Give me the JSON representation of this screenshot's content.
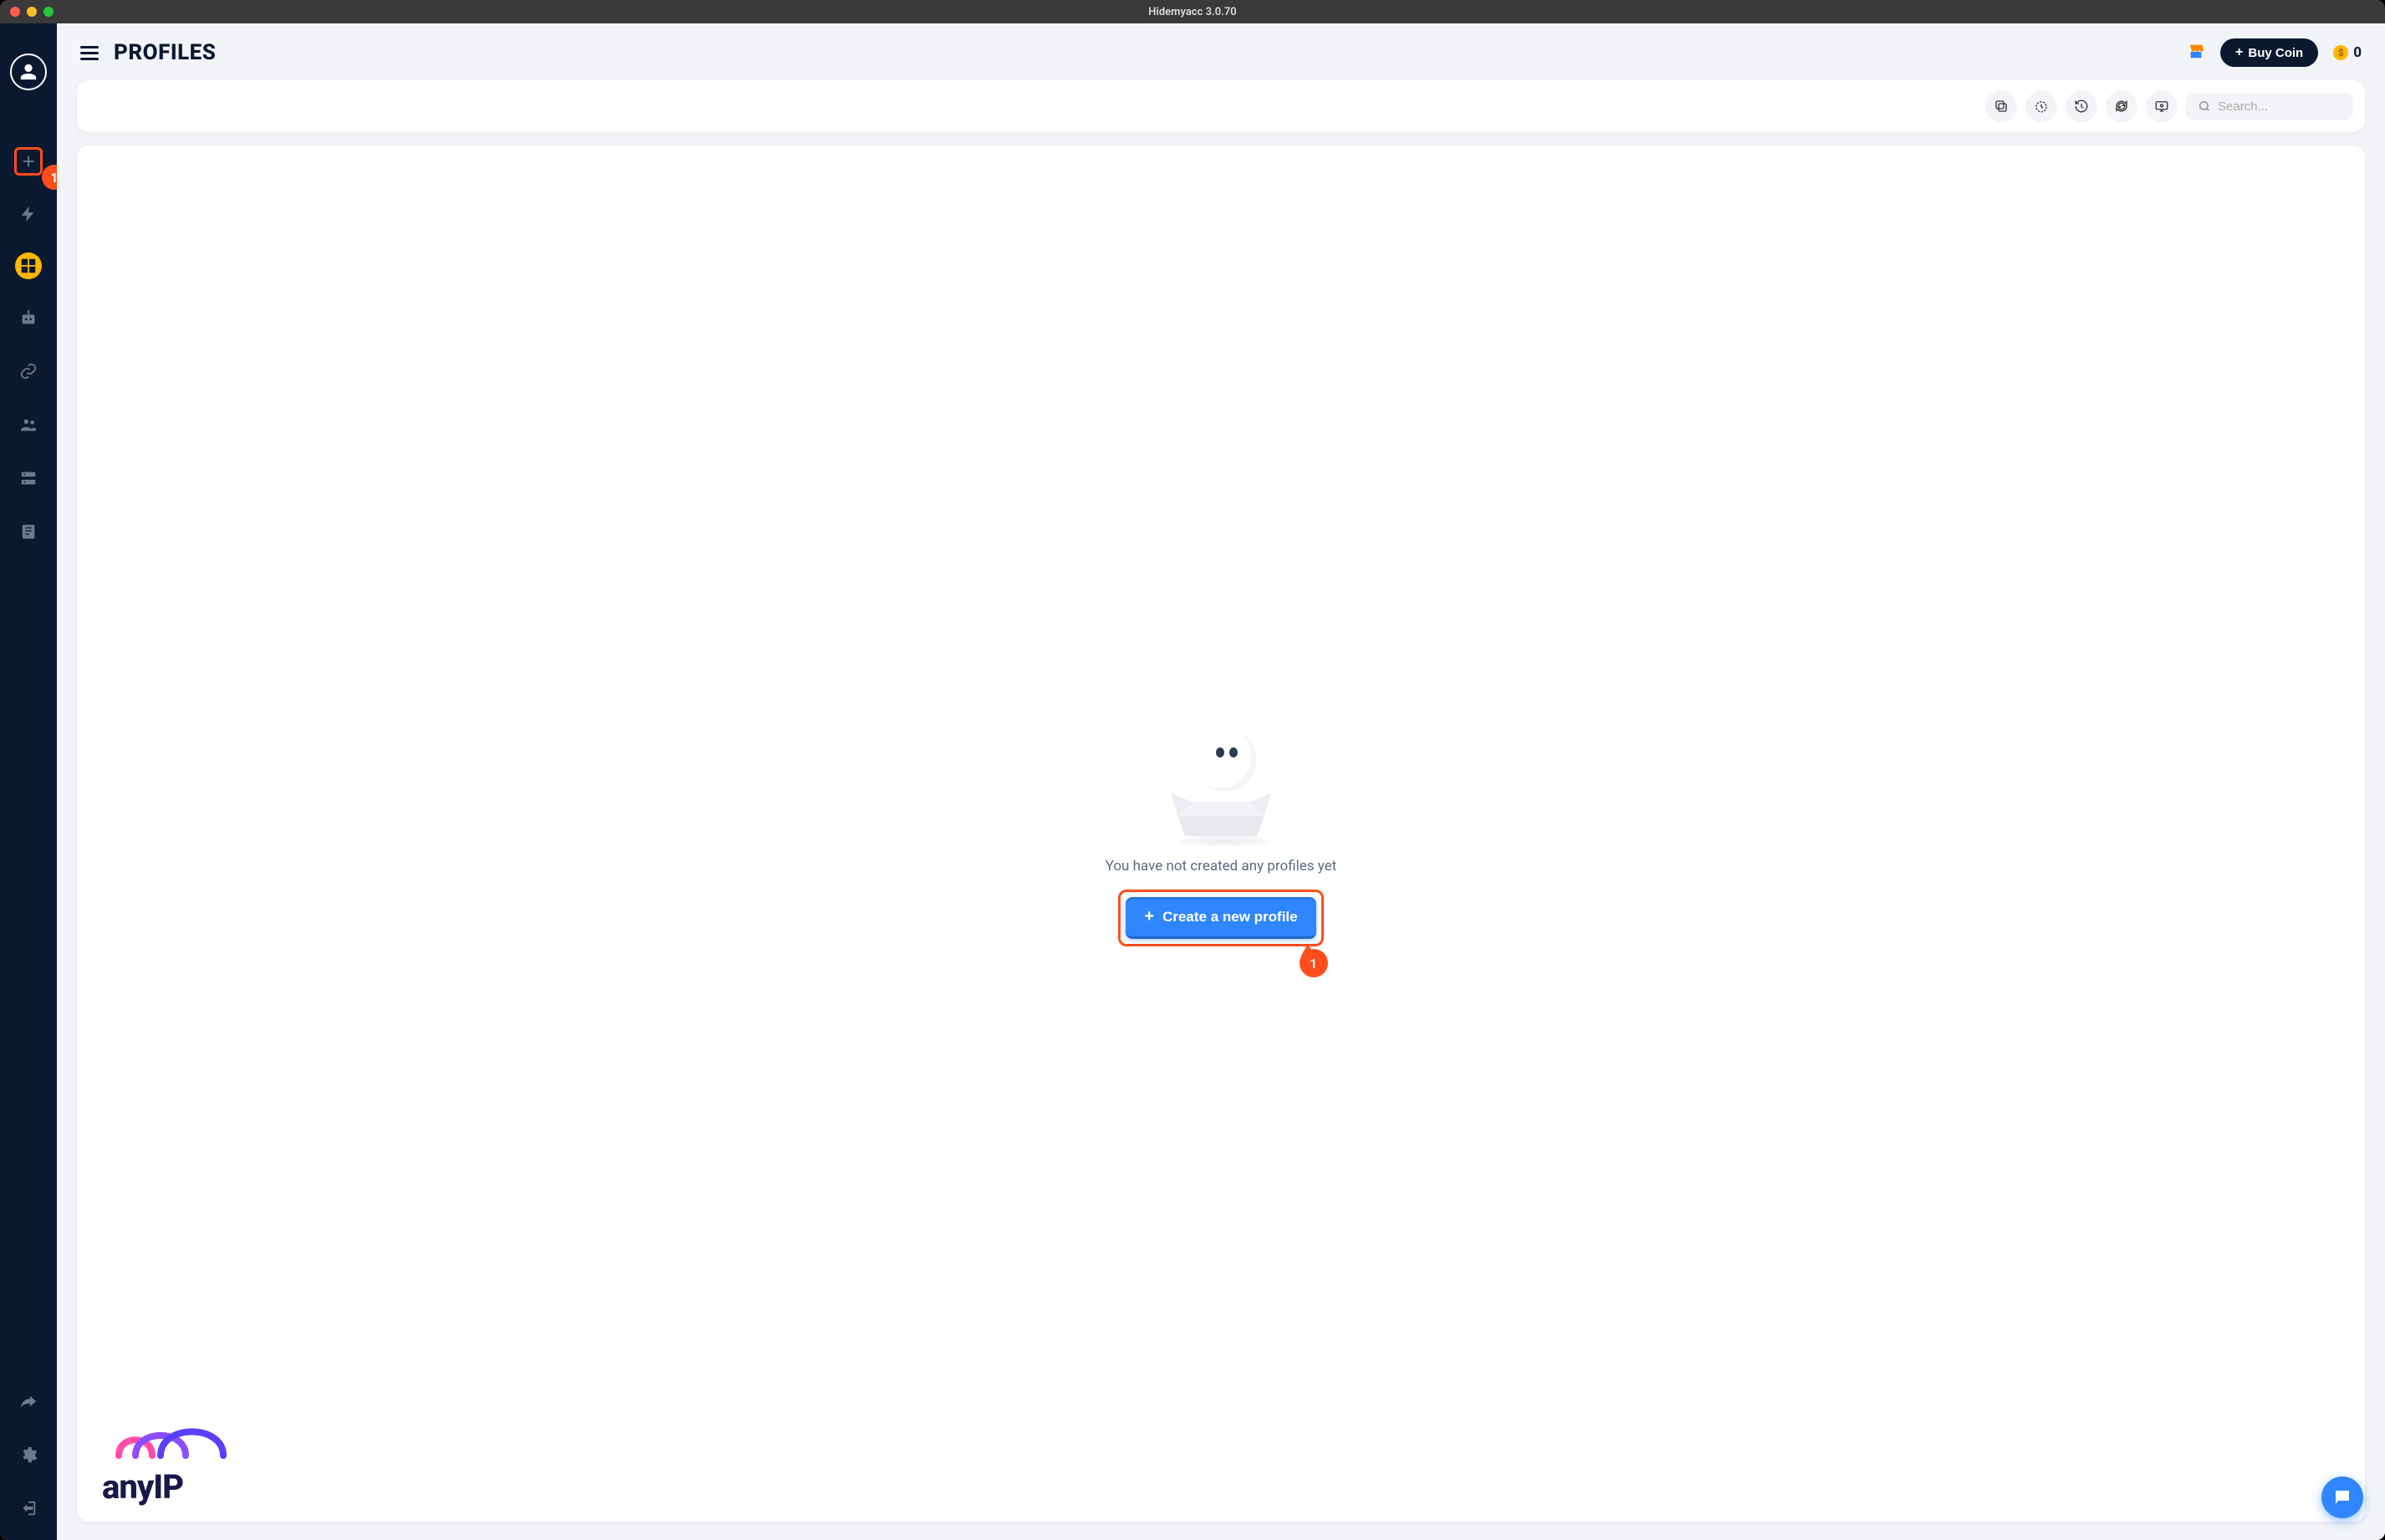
{
  "window": {
    "title": "Hidemyacc 3.0.70"
  },
  "header": {
    "page_title": "PROFILES",
    "buy_coin_label": "Buy Coin",
    "coin_balance": "0"
  },
  "toolbar": {
    "search_placeholder": "Search..."
  },
  "empty_state": {
    "message": "You have not created any profiles yet",
    "create_label": "Create a new profile"
  },
  "annotations": {
    "sidebar_add": "1",
    "create_button": "1"
  },
  "watermark": {
    "brand": "anyIP"
  },
  "sidebar": {
    "items": [
      "user-icon",
      "add-icon",
      "lightning-icon",
      "grid-icon",
      "robot-icon",
      "link-icon",
      "team-icon",
      "server-icon",
      "storage-icon"
    ],
    "bottom_items": [
      "share-icon",
      "gear-icon",
      "logout-icon"
    ]
  }
}
